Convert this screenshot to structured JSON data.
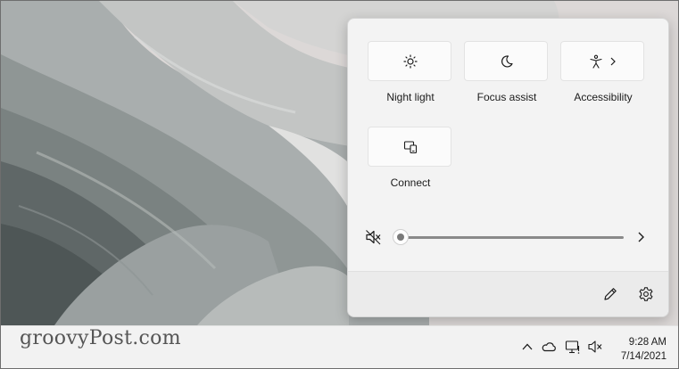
{
  "quick_settings": {
    "tiles": [
      {
        "label": "Night light",
        "icon": "night-light-icon"
      },
      {
        "label": "Focus assist",
        "icon": "focus-assist-icon"
      },
      {
        "label": "Accessibility",
        "icon": "accessibility-icon",
        "has_chevron": true
      },
      {
        "label": "Connect",
        "icon": "connect-icon"
      }
    ],
    "volume": {
      "level": 0,
      "muted": true,
      "icon": "speaker-muted-icon"
    },
    "footer": {
      "edit_icon": "pencil-icon",
      "settings_icon": "gear-icon"
    }
  },
  "watermark": {
    "text": "groovyPost.com"
  },
  "taskbar": {
    "tray_icons": [
      "chevron-up-icon",
      "onedrive-cloud-icon",
      "network-icon",
      "speaker-muted-icon"
    ],
    "clock": {
      "time": "9:28 AM",
      "date": "7/14/2021"
    }
  },
  "colors": {
    "flyout_bg": "#f3f3f3",
    "tile_bg": "#fbfbfb",
    "taskbar_bg": "#f2f2f2"
  }
}
